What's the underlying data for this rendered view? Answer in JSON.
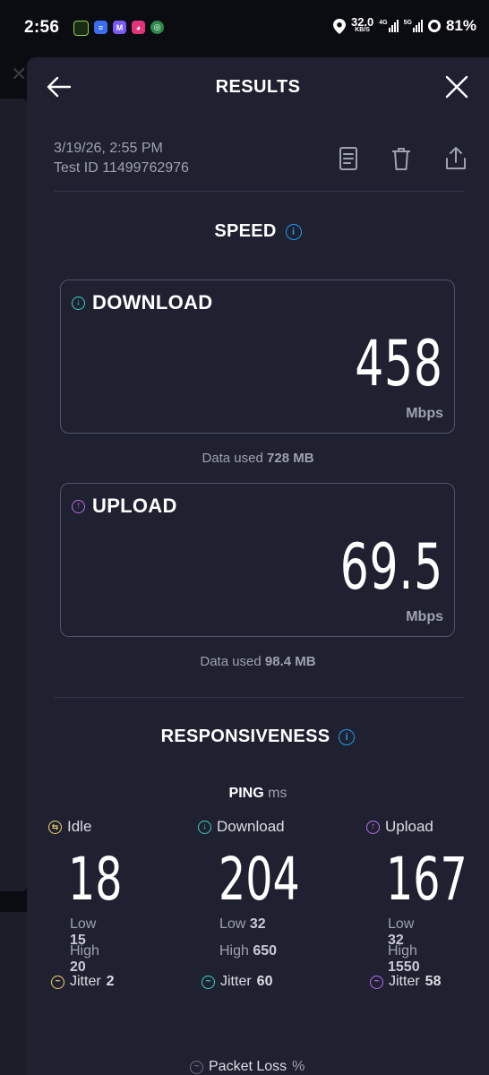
{
  "status_bar": {
    "time": "2:56",
    "net_speed": "32.0",
    "net_speed_unit": "KB/S",
    "net_4g": "4G",
    "net_5g": "5G",
    "battery": "81%"
  },
  "header": {
    "title": "RESULTS"
  },
  "meta": {
    "date": "3/19/26, 2:55 PM",
    "test_id": "Test ID 11499762976"
  },
  "speed": {
    "title": "SPEED",
    "download": {
      "label": "DOWNLOAD",
      "value": "458",
      "unit": "Mbps",
      "data_used_label": "Data used",
      "data_used_value": "728 MB"
    },
    "upload": {
      "label": "UPLOAD",
      "value": "69.5",
      "unit": "Mbps",
      "data_used_label": "Data used",
      "data_used_value": "98.4 MB"
    }
  },
  "responsiveness": {
    "title": "RESPONSIVENESS",
    "ping_label": "PING",
    "ping_unit": "ms",
    "low_label": "Low",
    "high_label": "High",
    "jitter_label": "Jitter",
    "idle": {
      "label": "Idle",
      "value": "18",
      "low": "15",
      "high": "20",
      "jitter": "2"
    },
    "download": {
      "label": "Download",
      "value": "204",
      "low": "32",
      "high": "650",
      "jitter": "60"
    },
    "upload": {
      "label": "Upload",
      "value": "167",
      "low": "32",
      "high": "1550",
      "jitter": "58"
    },
    "packet_loss_label": "Packet Loss",
    "packet_loss_unit": "%"
  },
  "colors": {
    "sheet": "#1f2131",
    "download_accent": "#3ad1c6",
    "upload_accent": "#b86cf2",
    "idle_accent": "#f3d36b",
    "info_blue": "#1d9bf0"
  }
}
